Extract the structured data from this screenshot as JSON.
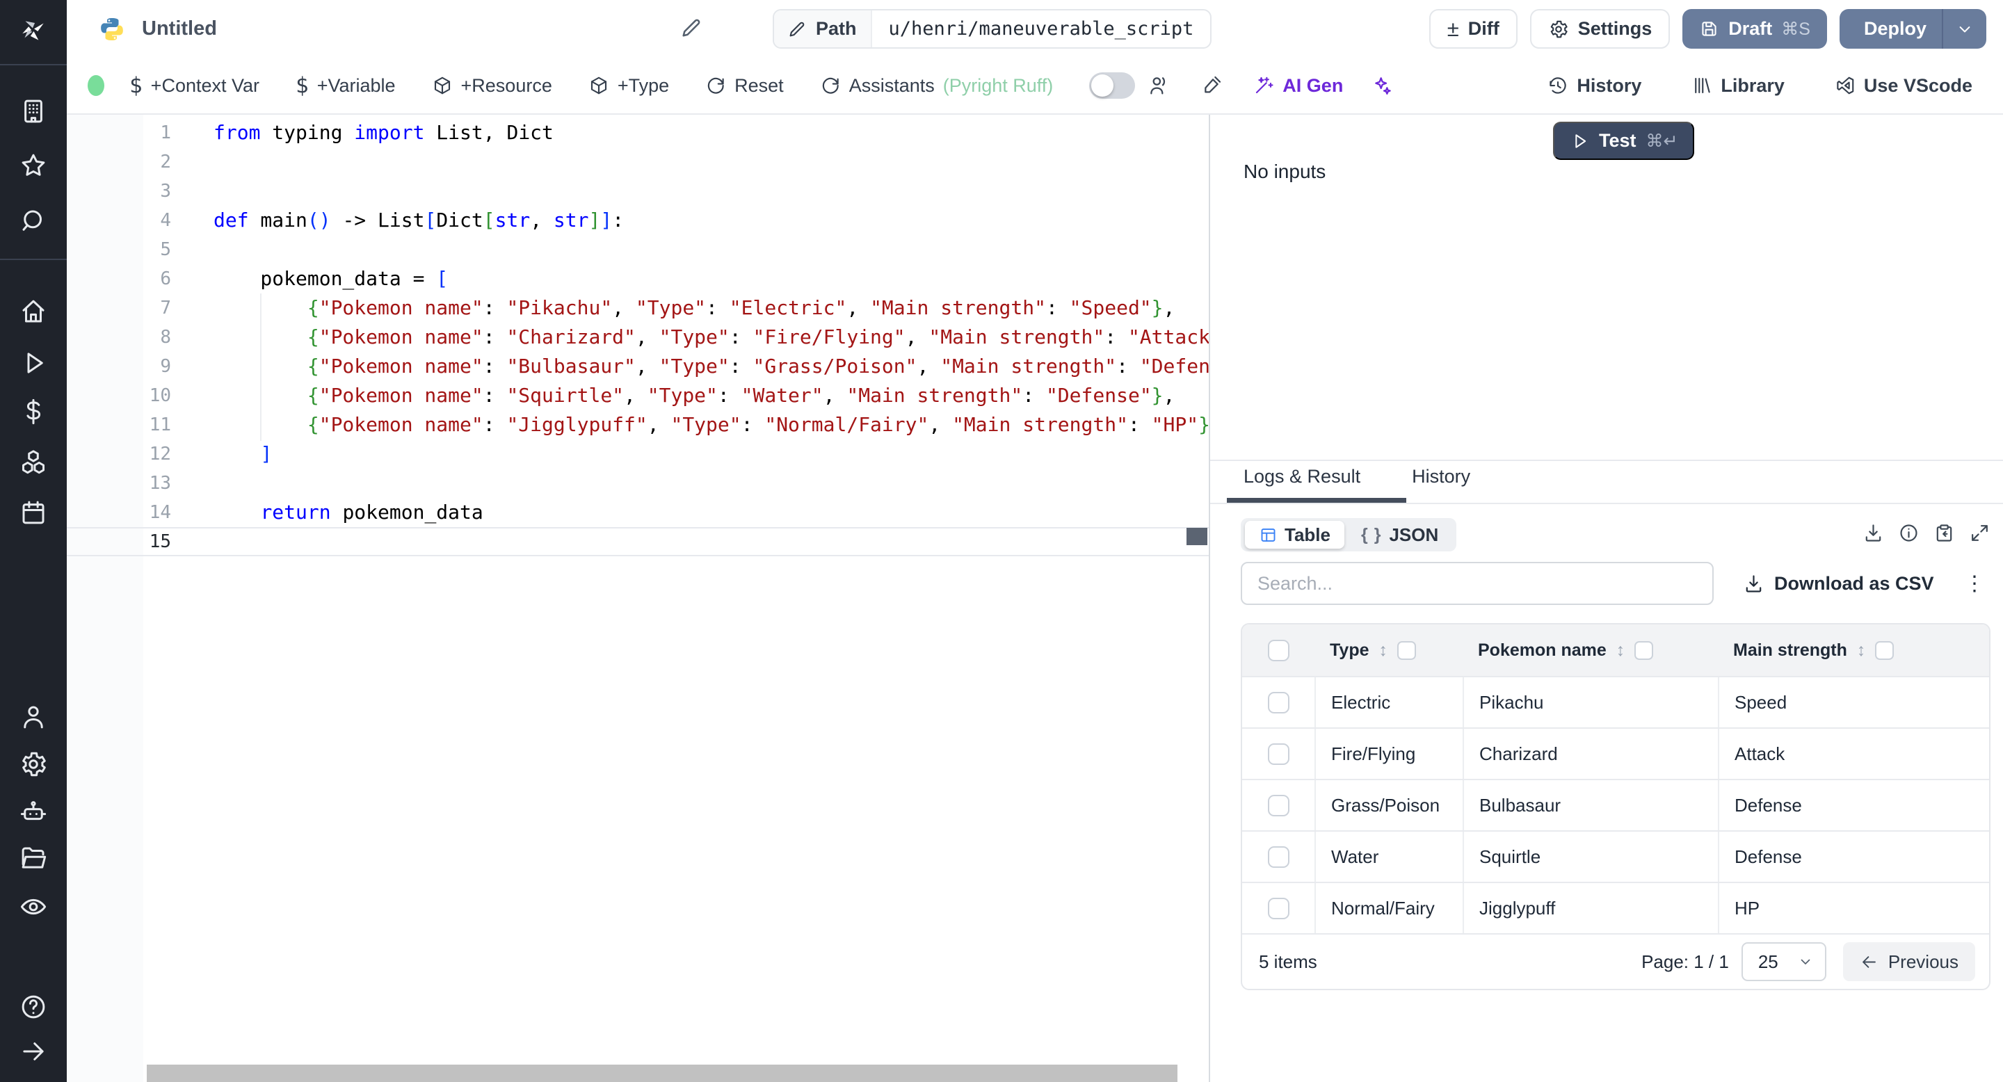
{
  "header": {
    "title": "Untitled",
    "path_label": "Path",
    "path_value": "u/henri/maneuverable_script",
    "diff": "Diff",
    "settings": "Settings",
    "draft": "Draft",
    "draft_shortcut": "⌘S",
    "deploy": "Deploy"
  },
  "toolbar": {
    "context_var": "+Context Var",
    "variable": "+Variable",
    "resource": "+Resource",
    "add_type": "+Type",
    "reset": "Reset",
    "assistants": "Assistants",
    "assistants_detail": "(Pyright Ruff)",
    "ai_gen": "AI Gen",
    "history": "History",
    "library": "Library",
    "use_vscode": "Use VScode"
  },
  "editor": {
    "language": "python",
    "lines": [
      {
        "n": 1,
        "toks": [
          [
            "kw",
            "from"
          ],
          [
            "pl",
            " typing "
          ],
          [
            "kw",
            "import"
          ],
          [
            "pl",
            " List, Dict"
          ]
        ]
      },
      {
        "n": 2,
        "toks": []
      },
      {
        "n": 3,
        "toks": []
      },
      {
        "n": 4,
        "toks": [
          [
            "kw",
            "def"
          ],
          [
            "pl",
            " main"
          ],
          [
            "b1",
            "()"
          ],
          [
            "pl",
            " -> List"
          ],
          [
            "b1",
            "["
          ],
          [
            "pl",
            "Dict"
          ],
          [
            "b2",
            "["
          ],
          [
            "kw",
            "str"
          ],
          [
            "pl",
            ", "
          ],
          [
            "kw",
            "str"
          ],
          [
            "b2",
            "]"
          ],
          [
            "b1",
            "]"
          ],
          [
            "pl",
            ":"
          ]
        ]
      },
      {
        "n": 5,
        "toks": []
      },
      {
        "n": 6,
        "toks": [
          [
            "pl",
            "    pokemon_data = "
          ],
          [
            "b1",
            "["
          ]
        ]
      },
      {
        "n": 7,
        "toks": [
          [
            "pl",
            "        "
          ],
          [
            "b2",
            "{"
          ],
          [
            "str",
            "\"Pokemon name\""
          ],
          [
            "pl",
            ": "
          ],
          [
            "str",
            "\"Pikachu\""
          ],
          [
            "pl",
            ", "
          ],
          [
            "str",
            "\"Type\""
          ],
          [
            "pl",
            ": "
          ],
          [
            "str",
            "\"Electric\""
          ],
          [
            "pl",
            ", "
          ],
          [
            "str",
            "\"Main strength\""
          ],
          [
            "pl",
            ": "
          ],
          [
            "str",
            "\"Speed\""
          ],
          [
            "b2",
            "}"
          ],
          [
            "pl",
            ","
          ]
        ]
      },
      {
        "n": 8,
        "toks": [
          [
            "pl",
            "        "
          ],
          [
            "b2",
            "{"
          ],
          [
            "str",
            "\"Pokemon name\""
          ],
          [
            "pl",
            ": "
          ],
          [
            "str",
            "\"Charizard\""
          ],
          [
            "pl",
            ", "
          ],
          [
            "str",
            "\"Type\""
          ],
          [
            "pl",
            ": "
          ],
          [
            "str",
            "\"Fire/Flying\""
          ],
          [
            "pl",
            ", "
          ],
          [
            "str",
            "\"Main strength\""
          ],
          [
            "pl",
            ": "
          ],
          [
            "str",
            "\"Attack\""
          ],
          [
            "b2",
            "}"
          ],
          [
            "pl",
            ","
          ]
        ]
      },
      {
        "n": 9,
        "toks": [
          [
            "pl",
            "        "
          ],
          [
            "b2",
            "{"
          ],
          [
            "str",
            "\"Pokemon name\""
          ],
          [
            "pl",
            ": "
          ],
          [
            "str",
            "\"Bulbasaur\""
          ],
          [
            "pl",
            ", "
          ],
          [
            "str",
            "\"Type\""
          ],
          [
            "pl",
            ": "
          ],
          [
            "str",
            "\"Grass/Poison\""
          ],
          [
            "pl",
            ", "
          ],
          [
            "str",
            "\"Main strength\""
          ],
          [
            "pl",
            ": "
          ],
          [
            "str",
            "\"Defense\""
          ],
          [
            "b2",
            "}"
          ],
          [
            "pl",
            ","
          ]
        ]
      },
      {
        "n": 10,
        "toks": [
          [
            "pl",
            "        "
          ],
          [
            "b2",
            "{"
          ],
          [
            "str",
            "\"Pokemon name\""
          ],
          [
            "pl",
            ": "
          ],
          [
            "str",
            "\"Squirtle\""
          ],
          [
            "pl",
            ", "
          ],
          [
            "str",
            "\"Type\""
          ],
          [
            "pl",
            ": "
          ],
          [
            "str",
            "\"Water\""
          ],
          [
            "pl",
            ", "
          ],
          [
            "str",
            "\"Main strength\""
          ],
          [
            "pl",
            ": "
          ],
          [
            "str",
            "\"Defense\""
          ],
          [
            "b2",
            "}"
          ],
          [
            "pl",
            ","
          ]
        ]
      },
      {
        "n": 11,
        "toks": [
          [
            "pl",
            "        "
          ],
          [
            "b2",
            "{"
          ],
          [
            "str",
            "\"Pokemon name\""
          ],
          [
            "pl",
            ": "
          ],
          [
            "str",
            "\"Jigglypuff\""
          ],
          [
            "pl",
            ", "
          ],
          [
            "str",
            "\"Type\""
          ],
          [
            "pl",
            ": "
          ],
          [
            "str",
            "\"Normal/Fairy\""
          ],
          [
            "pl",
            ", "
          ],
          [
            "str",
            "\"Main strength\""
          ],
          [
            "pl",
            ": "
          ],
          [
            "str",
            "\"HP\""
          ],
          [
            "b2",
            "}"
          ],
          [
            "pl",
            ","
          ]
        ]
      },
      {
        "n": 12,
        "toks": [
          [
            "pl",
            "    "
          ],
          [
            "b1",
            "]"
          ]
        ]
      },
      {
        "n": 13,
        "toks": []
      },
      {
        "n": 14,
        "toks": [
          [
            "pl",
            "    "
          ],
          [
            "kw",
            "return"
          ],
          [
            "pl",
            " pokemon_data"
          ]
        ]
      },
      {
        "n": 15,
        "toks": [],
        "cur": true
      }
    ]
  },
  "run": {
    "test": "Test",
    "test_shortcut": "⌘↵",
    "no_inputs": "No inputs"
  },
  "result": {
    "tab_logs": "Logs & Result",
    "tab_history": "History",
    "view_table": "Table",
    "view_json": "JSON",
    "search_placeholder": "Search...",
    "download_csv": "Download as CSV",
    "kebab": "⋮",
    "table": {
      "columns": [
        "Type",
        "Pokemon name",
        "Main strength"
      ],
      "sort_glyph": "↕",
      "rows": [
        [
          "Electric",
          "Pikachu",
          "Speed"
        ],
        [
          "Fire/Flying",
          "Charizard",
          "Attack"
        ],
        [
          "Grass/Poison",
          "Bulbasaur",
          "Defense"
        ],
        [
          "Water",
          "Squirtle",
          "Defense"
        ],
        [
          "Normal/Fairy",
          "Jigglypuff",
          "HP"
        ]
      ]
    },
    "footer": {
      "count": "5 items",
      "page": "Page: 1 / 1",
      "page_size": "25",
      "previous": "Previous"
    }
  },
  "sidebar": {
    "icons": [
      "windmill-logo",
      "workspace-icon",
      "favorites-icon",
      "search-icon",
      "home-icon",
      "runs-icon",
      "variables-icon",
      "resources-icon",
      "schedules-icon",
      "users-icon",
      "settings-icon",
      "workers-icon",
      "folders-icon",
      "audit-logs-icon",
      "help-icon",
      "expand-sidebar-icon"
    ]
  },
  "icons": [
    "python-icon",
    "pencil-icon",
    "diff-icon",
    "gear-icon",
    "save-icon",
    "chevron-down-icon",
    "dollar-icon",
    "package-icon",
    "rotate-icon",
    "multiplayer-icon",
    "format-brush-icon",
    "wand-icon",
    "sparkles-icon",
    "history-clock-icon",
    "library-icon",
    "vscode-icon",
    "play-icon",
    "download-icon",
    "info-icon",
    "copy-icon",
    "expand-icon",
    "table-grid-icon",
    "braces-icon",
    "arrow-left-icon"
  ],
  "colors": {
    "accent_button": "#697c9c",
    "test_button": "#3c4962",
    "ai_purple": "#6d28d9",
    "assistant_green": "#8fcfa9",
    "status_green": "#79dd9a",
    "keyword": "#0000ff",
    "string": "#a31515",
    "bracket_blue": "#0431fa",
    "bracket_green": "#319331",
    "table_icon_blue": "#3b82f6",
    "sidebar_bg": "#1f232b"
  }
}
